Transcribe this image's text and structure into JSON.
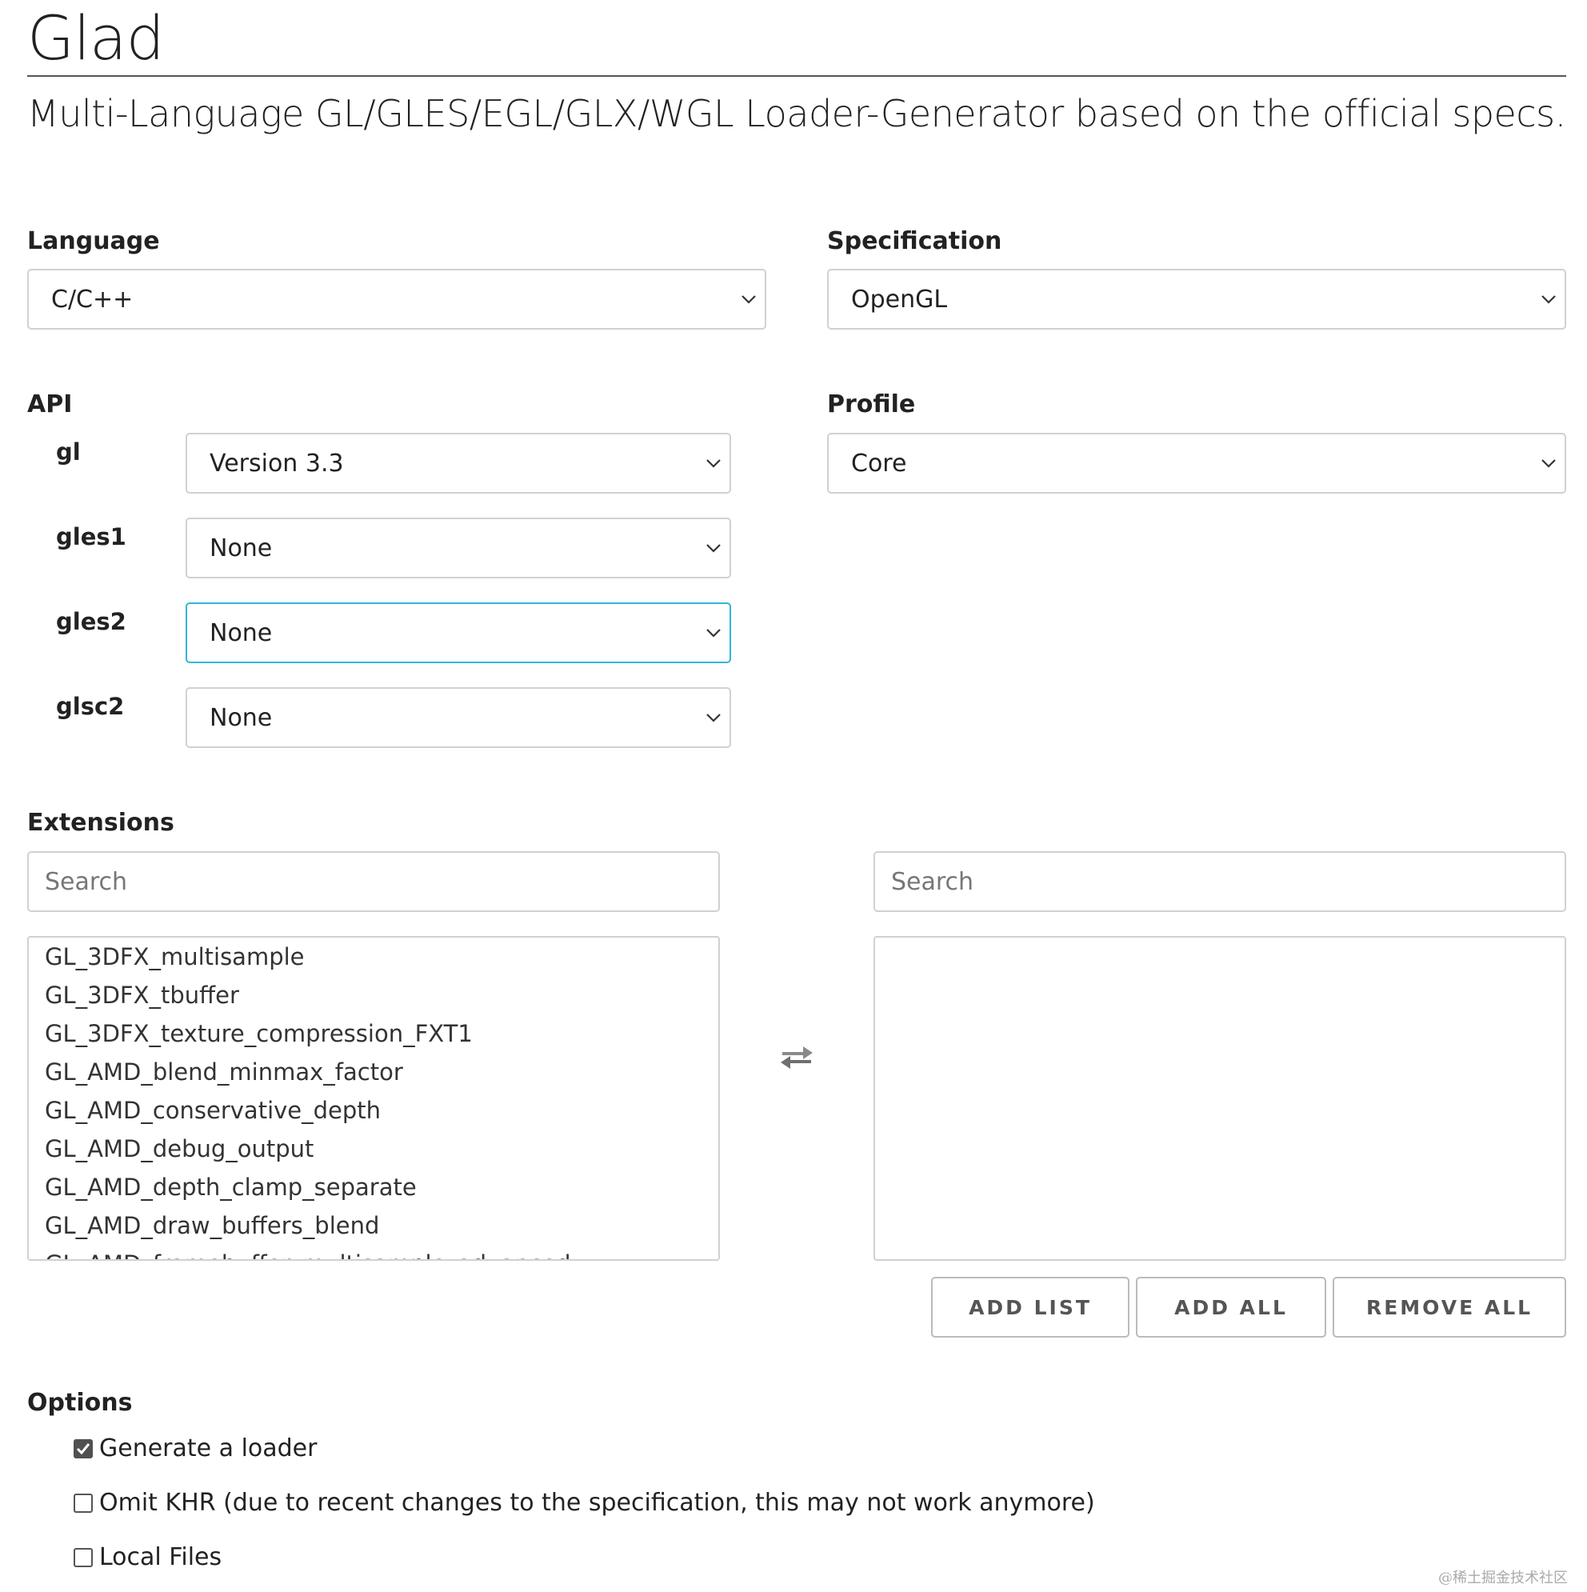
{
  "header": {
    "title": "Glad",
    "subtitle": "Multi-Language GL/GLES/EGL/GLX/WGL Loader-Generator based on the official specs."
  },
  "language": {
    "label": "Language",
    "value": "C/C++"
  },
  "specification": {
    "label": "Specification",
    "value": "OpenGL"
  },
  "api": {
    "label": "API",
    "rows": [
      {
        "name": "gl",
        "value": "Version 3.3"
      },
      {
        "name": "gles1",
        "value": "None"
      },
      {
        "name": "gles2",
        "value": "None"
      },
      {
        "name": "glsc2",
        "value": "None"
      }
    ]
  },
  "profile": {
    "label": "Profile",
    "value": "Core"
  },
  "extensions": {
    "label": "Extensions",
    "left_search_placeholder": "Search",
    "right_search_placeholder": "Search",
    "available": [
      "GL_3DFX_multisample",
      "GL_3DFX_tbuffer",
      "GL_3DFX_texture_compression_FXT1",
      "GL_AMD_blend_minmax_factor",
      "GL_AMD_conservative_depth",
      "GL_AMD_debug_output",
      "GL_AMD_depth_clamp_separate",
      "GL_AMD_draw_buffers_blend",
      "GL_AMD_framebuffer_multisample_advanced"
    ],
    "selected": [],
    "add_list_label": "ADD LIST",
    "add_all_label": "ADD ALL",
    "remove_all_label": "REMOVE ALL"
  },
  "options": {
    "label": "Options",
    "items": [
      {
        "label": "Generate a loader",
        "checked": true
      },
      {
        "label": "Omit KHR (due to recent changes to the specification, this may not work anymore)",
        "checked": false
      },
      {
        "label": "Local Files",
        "checked": false
      }
    ]
  },
  "watermark": "@稀土掘金技术社区",
  "colors": {
    "focus_border": "#33b5d8",
    "border": "#d1d1d1",
    "text": "#222222"
  }
}
